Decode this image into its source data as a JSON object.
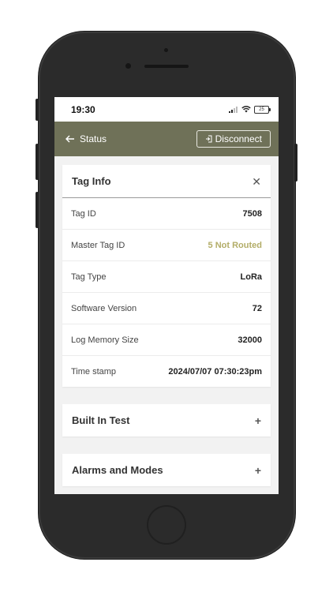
{
  "status_bar": {
    "time": "19:30",
    "battery": "25",
    "icons": [
      "signal-icon",
      "wifi-icon",
      "battery-icon"
    ]
  },
  "header": {
    "back_label": "Status",
    "disconnect_label": "Disconnect",
    "color": "#6f7158"
  },
  "tag_info": {
    "title": "Tag Info",
    "rows": [
      {
        "label": "Tag ID",
        "value": "7508"
      },
      {
        "label": "Master Tag ID",
        "value": "5 Not Routed"
      },
      {
        "label": "Tag Type",
        "value": "LoRa"
      },
      {
        "label": "Software Version",
        "value": "72"
      },
      {
        "label": "Log Memory Size",
        "value": "32000"
      },
      {
        "label": "Time stamp",
        "value": "2024/07/07 07:30:23pm"
      }
    ]
  },
  "sections": [
    {
      "title": "Built In Test"
    },
    {
      "title": "Alarms and Modes"
    }
  ],
  "colors": {
    "accent": "#6f7158",
    "warning_text": "#b3ad68"
  }
}
